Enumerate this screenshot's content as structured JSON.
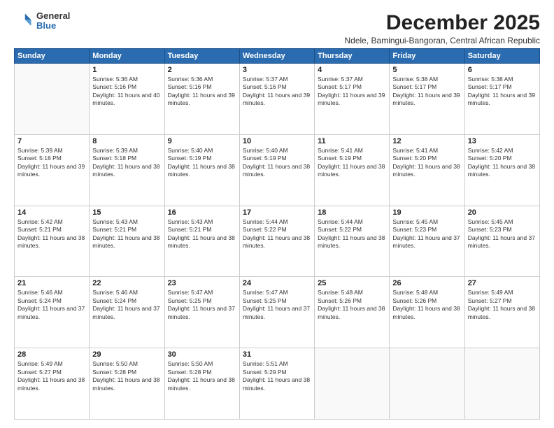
{
  "logo": {
    "general": "General",
    "blue": "Blue"
  },
  "title": "December 2025",
  "subtitle": "Ndele, Bamingui-Bangoran, Central African Republic",
  "days_of_week": [
    "Sunday",
    "Monday",
    "Tuesday",
    "Wednesday",
    "Thursday",
    "Friday",
    "Saturday"
  ],
  "weeks": [
    [
      {
        "day": "",
        "sunrise": "",
        "sunset": "",
        "daylight": ""
      },
      {
        "day": "1",
        "sunrise": "Sunrise: 5:36 AM",
        "sunset": "Sunset: 5:16 PM",
        "daylight": "Daylight: 11 hours and 40 minutes."
      },
      {
        "day": "2",
        "sunrise": "Sunrise: 5:36 AM",
        "sunset": "Sunset: 5:16 PM",
        "daylight": "Daylight: 11 hours and 39 minutes."
      },
      {
        "day": "3",
        "sunrise": "Sunrise: 5:37 AM",
        "sunset": "Sunset: 5:16 PM",
        "daylight": "Daylight: 11 hours and 39 minutes."
      },
      {
        "day": "4",
        "sunrise": "Sunrise: 5:37 AM",
        "sunset": "Sunset: 5:17 PM",
        "daylight": "Daylight: 11 hours and 39 minutes."
      },
      {
        "day": "5",
        "sunrise": "Sunrise: 5:38 AM",
        "sunset": "Sunset: 5:17 PM",
        "daylight": "Daylight: 11 hours and 39 minutes."
      },
      {
        "day": "6",
        "sunrise": "Sunrise: 5:38 AM",
        "sunset": "Sunset: 5:17 PM",
        "daylight": "Daylight: 11 hours and 39 minutes."
      }
    ],
    [
      {
        "day": "7",
        "sunrise": "Sunrise: 5:39 AM",
        "sunset": "Sunset: 5:18 PM",
        "daylight": "Daylight: 11 hours and 39 minutes."
      },
      {
        "day": "8",
        "sunrise": "Sunrise: 5:39 AM",
        "sunset": "Sunset: 5:18 PM",
        "daylight": "Daylight: 11 hours and 38 minutes."
      },
      {
        "day": "9",
        "sunrise": "Sunrise: 5:40 AM",
        "sunset": "Sunset: 5:19 PM",
        "daylight": "Daylight: 11 hours and 38 minutes."
      },
      {
        "day": "10",
        "sunrise": "Sunrise: 5:40 AM",
        "sunset": "Sunset: 5:19 PM",
        "daylight": "Daylight: 11 hours and 38 minutes."
      },
      {
        "day": "11",
        "sunrise": "Sunrise: 5:41 AM",
        "sunset": "Sunset: 5:19 PM",
        "daylight": "Daylight: 11 hours and 38 minutes."
      },
      {
        "day": "12",
        "sunrise": "Sunrise: 5:41 AM",
        "sunset": "Sunset: 5:20 PM",
        "daylight": "Daylight: 11 hours and 38 minutes."
      },
      {
        "day": "13",
        "sunrise": "Sunrise: 5:42 AM",
        "sunset": "Sunset: 5:20 PM",
        "daylight": "Daylight: 11 hours and 38 minutes."
      }
    ],
    [
      {
        "day": "14",
        "sunrise": "Sunrise: 5:42 AM",
        "sunset": "Sunset: 5:21 PM",
        "daylight": "Daylight: 11 hours and 38 minutes."
      },
      {
        "day": "15",
        "sunrise": "Sunrise: 5:43 AM",
        "sunset": "Sunset: 5:21 PM",
        "daylight": "Daylight: 11 hours and 38 minutes."
      },
      {
        "day": "16",
        "sunrise": "Sunrise: 5:43 AM",
        "sunset": "Sunset: 5:21 PM",
        "daylight": "Daylight: 11 hours and 38 minutes."
      },
      {
        "day": "17",
        "sunrise": "Sunrise: 5:44 AM",
        "sunset": "Sunset: 5:22 PM",
        "daylight": "Daylight: 11 hours and 38 minutes."
      },
      {
        "day": "18",
        "sunrise": "Sunrise: 5:44 AM",
        "sunset": "Sunset: 5:22 PM",
        "daylight": "Daylight: 11 hours and 38 minutes."
      },
      {
        "day": "19",
        "sunrise": "Sunrise: 5:45 AM",
        "sunset": "Sunset: 5:23 PM",
        "daylight": "Daylight: 11 hours and 37 minutes."
      },
      {
        "day": "20",
        "sunrise": "Sunrise: 5:45 AM",
        "sunset": "Sunset: 5:23 PM",
        "daylight": "Daylight: 11 hours and 37 minutes."
      }
    ],
    [
      {
        "day": "21",
        "sunrise": "Sunrise: 5:46 AM",
        "sunset": "Sunset: 5:24 PM",
        "daylight": "Daylight: 11 hours and 37 minutes."
      },
      {
        "day": "22",
        "sunrise": "Sunrise: 5:46 AM",
        "sunset": "Sunset: 5:24 PM",
        "daylight": "Daylight: 11 hours and 37 minutes."
      },
      {
        "day": "23",
        "sunrise": "Sunrise: 5:47 AM",
        "sunset": "Sunset: 5:25 PM",
        "daylight": "Daylight: 11 hours and 37 minutes."
      },
      {
        "day": "24",
        "sunrise": "Sunrise: 5:47 AM",
        "sunset": "Sunset: 5:25 PM",
        "daylight": "Daylight: 11 hours and 37 minutes."
      },
      {
        "day": "25",
        "sunrise": "Sunrise: 5:48 AM",
        "sunset": "Sunset: 5:26 PM",
        "daylight": "Daylight: 11 hours and 38 minutes."
      },
      {
        "day": "26",
        "sunrise": "Sunrise: 5:48 AM",
        "sunset": "Sunset: 5:26 PM",
        "daylight": "Daylight: 11 hours and 38 minutes."
      },
      {
        "day": "27",
        "sunrise": "Sunrise: 5:49 AM",
        "sunset": "Sunset: 5:27 PM",
        "daylight": "Daylight: 11 hours and 38 minutes."
      }
    ],
    [
      {
        "day": "28",
        "sunrise": "Sunrise: 5:49 AM",
        "sunset": "Sunset: 5:27 PM",
        "daylight": "Daylight: 11 hours and 38 minutes."
      },
      {
        "day": "29",
        "sunrise": "Sunrise: 5:50 AM",
        "sunset": "Sunset: 5:28 PM",
        "daylight": "Daylight: 11 hours and 38 minutes."
      },
      {
        "day": "30",
        "sunrise": "Sunrise: 5:50 AM",
        "sunset": "Sunset: 5:28 PM",
        "daylight": "Daylight: 11 hours and 38 minutes."
      },
      {
        "day": "31",
        "sunrise": "Sunrise: 5:51 AM",
        "sunset": "Sunset: 5:29 PM",
        "daylight": "Daylight: 11 hours and 38 minutes."
      },
      {
        "day": "",
        "sunrise": "",
        "sunset": "",
        "daylight": ""
      },
      {
        "day": "",
        "sunrise": "",
        "sunset": "",
        "daylight": ""
      },
      {
        "day": "",
        "sunrise": "",
        "sunset": "",
        "daylight": ""
      }
    ]
  ]
}
